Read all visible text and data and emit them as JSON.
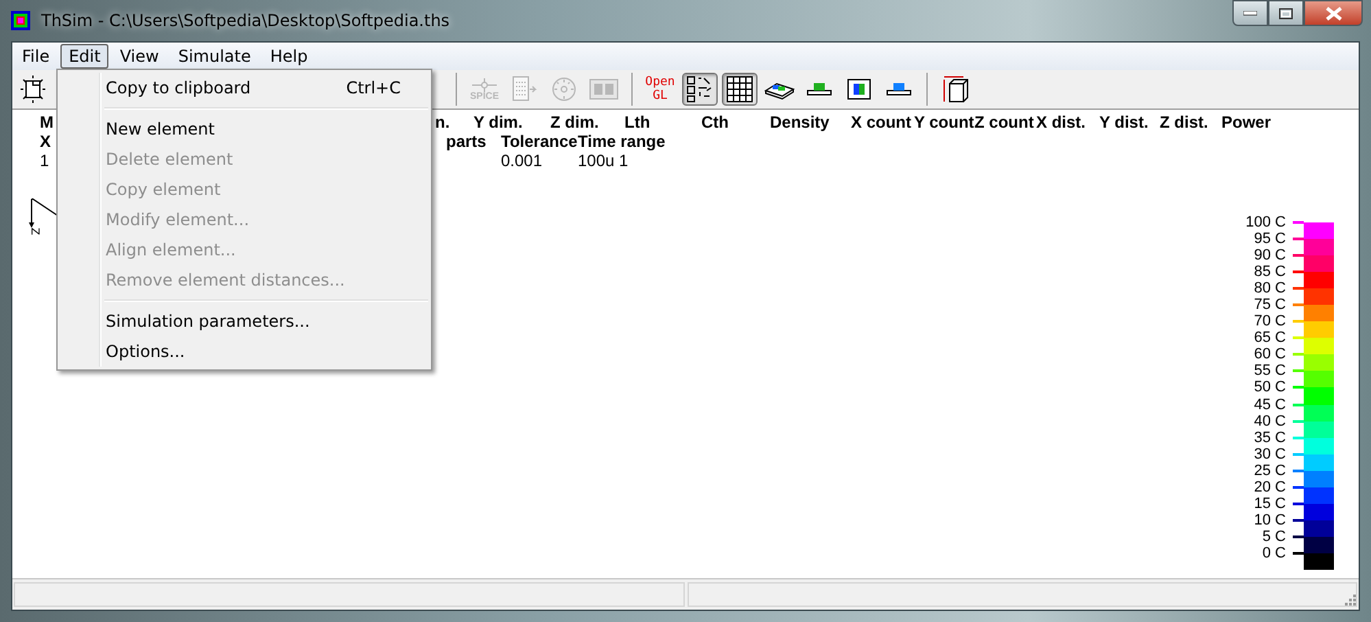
{
  "window": {
    "title": "ThSim - C:\\Users\\Softpedia\\Desktop\\Softpedia.ths"
  },
  "menu_bar": [
    {
      "label": "File",
      "selected": false
    },
    {
      "label": "Edit",
      "selected": true
    },
    {
      "label": "View",
      "selected": false
    },
    {
      "label": "Simulate",
      "selected": false
    },
    {
      "label": "Help",
      "selected": false
    }
  ],
  "toolbar": {
    "left": [
      {
        "kind": "new",
        "disabled": false,
        "pressed": false
      }
    ],
    "right": [
      {
        "kind": "sep"
      },
      {
        "kind": "spice",
        "label": "SPICE",
        "disabled": true,
        "pressed": false
      },
      {
        "kind": "export",
        "disabled": true,
        "pressed": false
      },
      {
        "kind": "dial",
        "disabled": true,
        "pressed": false
      },
      {
        "kind": "film",
        "disabled": true,
        "pressed": false
      },
      {
        "kind": "sep"
      },
      {
        "kind": "opengl",
        "label": "Open",
        "label2": "GL",
        "disabled": false,
        "pressed": false
      },
      {
        "kind": "pattern",
        "disabled": false,
        "pressed": true
      },
      {
        "kind": "grid",
        "disabled": false,
        "pressed": true
      },
      {
        "kind": "layers",
        "disabled": false,
        "pressed": false
      },
      {
        "kind": "block",
        "disabled": false,
        "pressed": false
      },
      {
        "kind": "frame",
        "disabled": false,
        "pressed": false
      },
      {
        "kind": "plate",
        "disabled": false,
        "pressed": false
      },
      {
        "kind": "sep"
      },
      {
        "kind": "cube",
        "disabled": false,
        "pressed": false
      }
    ]
  },
  "table": {
    "rows": [
      {
        "kind": "header",
        "cells": [
          "M",
          "n.",
          "Y dim.",
          "Z dim.",
          "Lth",
          "Cth",
          "Density",
          "X count",
          "Y count",
          "Z count",
          "X dist.",
          "Y dist.",
          "Z dist.",
          "Power"
        ]
      },
      {
        "kind": "header",
        "cells": [
          "X",
          "parts",
          "Tolerance",
          "Time range"
        ]
      },
      {
        "kind": "value",
        "cells": [
          "1",
          "0.001",
          "100u 1"
        ]
      }
    ]
  },
  "axis": {
    "label": "Z"
  },
  "color_scale": [
    {
      "label": "100 C",
      "color": "#ff00ff"
    },
    {
      "label": "95 C",
      "color": "#ff0099"
    },
    {
      "label": "90 C",
      "color": "#ff0066"
    },
    {
      "label": "85 C",
      "color": "#ff0000"
    },
    {
      "label": "80 C",
      "color": "#ff3300"
    },
    {
      "label": "75 C",
      "color": "#ff8000"
    },
    {
      "label": "70 C",
      "color": "#ffcc00"
    },
    {
      "label": "65 C",
      "color": "#ddff00"
    },
    {
      "label": "60 C",
      "color": "#99ff00"
    },
    {
      "label": "55 C",
      "color": "#55ff00"
    },
    {
      "label": "50 C",
      "color": "#00ff00"
    },
    {
      "label": "45 C",
      "color": "#00ff55"
    },
    {
      "label": "40 C",
      "color": "#00ff99"
    },
    {
      "label": "35 C",
      "color": "#00ffdd"
    },
    {
      "label": "30 C",
      "color": "#00ccff"
    },
    {
      "label": "25 C",
      "color": "#0080ff"
    },
    {
      "label": "20 C",
      "color": "#0033ff"
    },
    {
      "label": "15 C",
      "color": "#0000dd"
    },
    {
      "label": "10 C",
      "color": "#000099"
    },
    {
      "label": "5 C",
      "color": "#000044"
    },
    {
      "label": "0 C",
      "color": "#000000"
    }
  ],
  "edit_menu": [
    {
      "kind": "item",
      "label": "Copy to clipboard",
      "shortcut": "Ctrl+C",
      "disabled": false
    },
    {
      "kind": "sep"
    },
    {
      "kind": "item",
      "label": "New element",
      "disabled": false
    },
    {
      "kind": "item",
      "label": "Delete element",
      "disabled": true
    },
    {
      "kind": "item",
      "label": "Copy element",
      "disabled": true
    },
    {
      "kind": "item",
      "label": "Modify element...",
      "disabled": true
    },
    {
      "kind": "item",
      "label": "Align element...",
      "disabled": true
    },
    {
      "kind": "item",
      "label": "Remove element distances...",
      "disabled": true
    },
    {
      "kind": "sep"
    },
    {
      "kind": "item",
      "label": "Simulation parameters...",
      "disabled": false
    },
    {
      "kind": "item",
      "label": "Options...",
      "disabled": false
    }
  ]
}
